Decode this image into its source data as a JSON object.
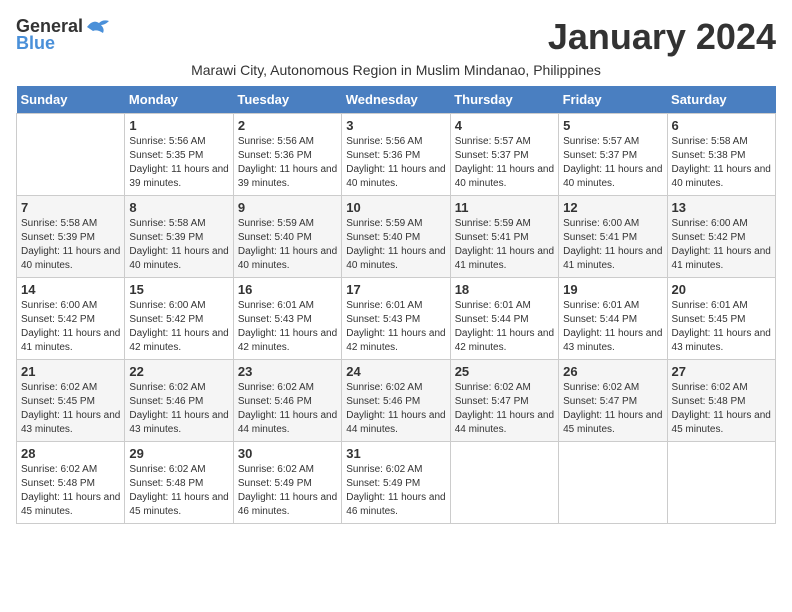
{
  "header": {
    "logo_general": "General",
    "logo_blue": "Blue",
    "month_title": "January 2024",
    "subtitle": "Marawi City, Autonomous Region in Muslim Mindanao, Philippines"
  },
  "days_of_week": [
    "Sunday",
    "Monday",
    "Tuesday",
    "Wednesday",
    "Thursday",
    "Friday",
    "Saturday"
  ],
  "weeks": [
    [
      {
        "day": "",
        "sunrise": "",
        "sunset": "",
        "daylight": ""
      },
      {
        "day": "1",
        "sunrise": "Sunrise: 5:56 AM",
        "sunset": "Sunset: 5:35 PM",
        "daylight": "Daylight: 11 hours and 39 minutes."
      },
      {
        "day": "2",
        "sunrise": "Sunrise: 5:56 AM",
        "sunset": "Sunset: 5:36 PM",
        "daylight": "Daylight: 11 hours and 39 minutes."
      },
      {
        "day": "3",
        "sunrise": "Sunrise: 5:56 AM",
        "sunset": "Sunset: 5:36 PM",
        "daylight": "Daylight: 11 hours and 40 minutes."
      },
      {
        "day": "4",
        "sunrise": "Sunrise: 5:57 AM",
        "sunset": "Sunset: 5:37 PM",
        "daylight": "Daylight: 11 hours and 40 minutes."
      },
      {
        "day": "5",
        "sunrise": "Sunrise: 5:57 AM",
        "sunset": "Sunset: 5:37 PM",
        "daylight": "Daylight: 11 hours and 40 minutes."
      },
      {
        "day": "6",
        "sunrise": "Sunrise: 5:58 AM",
        "sunset": "Sunset: 5:38 PM",
        "daylight": "Daylight: 11 hours and 40 minutes."
      }
    ],
    [
      {
        "day": "7",
        "sunrise": "Sunrise: 5:58 AM",
        "sunset": "Sunset: 5:39 PM",
        "daylight": "Daylight: 11 hours and 40 minutes."
      },
      {
        "day": "8",
        "sunrise": "Sunrise: 5:58 AM",
        "sunset": "Sunset: 5:39 PM",
        "daylight": "Daylight: 11 hours and 40 minutes."
      },
      {
        "day": "9",
        "sunrise": "Sunrise: 5:59 AM",
        "sunset": "Sunset: 5:40 PM",
        "daylight": "Daylight: 11 hours and 40 minutes."
      },
      {
        "day": "10",
        "sunrise": "Sunrise: 5:59 AM",
        "sunset": "Sunset: 5:40 PM",
        "daylight": "Daylight: 11 hours and 40 minutes."
      },
      {
        "day": "11",
        "sunrise": "Sunrise: 5:59 AM",
        "sunset": "Sunset: 5:41 PM",
        "daylight": "Daylight: 11 hours and 41 minutes."
      },
      {
        "day": "12",
        "sunrise": "Sunrise: 6:00 AM",
        "sunset": "Sunset: 5:41 PM",
        "daylight": "Daylight: 11 hours and 41 minutes."
      },
      {
        "day": "13",
        "sunrise": "Sunrise: 6:00 AM",
        "sunset": "Sunset: 5:42 PM",
        "daylight": "Daylight: 11 hours and 41 minutes."
      }
    ],
    [
      {
        "day": "14",
        "sunrise": "Sunrise: 6:00 AM",
        "sunset": "Sunset: 5:42 PM",
        "daylight": "Daylight: 11 hours and 41 minutes."
      },
      {
        "day": "15",
        "sunrise": "Sunrise: 6:00 AM",
        "sunset": "Sunset: 5:42 PM",
        "daylight": "Daylight: 11 hours and 42 minutes."
      },
      {
        "day": "16",
        "sunrise": "Sunrise: 6:01 AM",
        "sunset": "Sunset: 5:43 PM",
        "daylight": "Daylight: 11 hours and 42 minutes."
      },
      {
        "day": "17",
        "sunrise": "Sunrise: 6:01 AM",
        "sunset": "Sunset: 5:43 PM",
        "daylight": "Daylight: 11 hours and 42 minutes."
      },
      {
        "day": "18",
        "sunrise": "Sunrise: 6:01 AM",
        "sunset": "Sunset: 5:44 PM",
        "daylight": "Daylight: 11 hours and 42 minutes."
      },
      {
        "day": "19",
        "sunrise": "Sunrise: 6:01 AM",
        "sunset": "Sunset: 5:44 PM",
        "daylight": "Daylight: 11 hours and 43 minutes."
      },
      {
        "day": "20",
        "sunrise": "Sunrise: 6:01 AM",
        "sunset": "Sunset: 5:45 PM",
        "daylight": "Daylight: 11 hours and 43 minutes."
      }
    ],
    [
      {
        "day": "21",
        "sunrise": "Sunrise: 6:02 AM",
        "sunset": "Sunset: 5:45 PM",
        "daylight": "Daylight: 11 hours and 43 minutes."
      },
      {
        "day": "22",
        "sunrise": "Sunrise: 6:02 AM",
        "sunset": "Sunset: 5:46 PM",
        "daylight": "Daylight: 11 hours and 43 minutes."
      },
      {
        "day": "23",
        "sunrise": "Sunrise: 6:02 AM",
        "sunset": "Sunset: 5:46 PM",
        "daylight": "Daylight: 11 hours and 44 minutes."
      },
      {
        "day": "24",
        "sunrise": "Sunrise: 6:02 AM",
        "sunset": "Sunset: 5:46 PM",
        "daylight": "Daylight: 11 hours and 44 minutes."
      },
      {
        "day": "25",
        "sunrise": "Sunrise: 6:02 AM",
        "sunset": "Sunset: 5:47 PM",
        "daylight": "Daylight: 11 hours and 44 minutes."
      },
      {
        "day": "26",
        "sunrise": "Sunrise: 6:02 AM",
        "sunset": "Sunset: 5:47 PM",
        "daylight": "Daylight: 11 hours and 45 minutes."
      },
      {
        "day": "27",
        "sunrise": "Sunrise: 6:02 AM",
        "sunset": "Sunset: 5:48 PM",
        "daylight": "Daylight: 11 hours and 45 minutes."
      }
    ],
    [
      {
        "day": "28",
        "sunrise": "Sunrise: 6:02 AM",
        "sunset": "Sunset: 5:48 PM",
        "daylight": "Daylight: 11 hours and 45 minutes."
      },
      {
        "day": "29",
        "sunrise": "Sunrise: 6:02 AM",
        "sunset": "Sunset: 5:48 PM",
        "daylight": "Daylight: 11 hours and 45 minutes."
      },
      {
        "day": "30",
        "sunrise": "Sunrise: 6:02 AM",
        "sunset": "Sunset: 5:49 PM",
        "daylight": "Daylight: 11 hours and 46 minutes."
      },
      {
        "day": "31",
        "sunrise": "Sunrise: 6:02 AM",
        "sunset": "Sunset: 5:49 PM",
        "daylight": "Daylight: 11 hours and 46 minutes."
      },
      {
        "day": "",
        "sunrise": "",
        "sunset": "",
        "daylight": ""
      },
      {
        "day": "",
        "sunrise": "",
        "sunset": "",
        "daylight": ""
      },
      {
        "day": "",
        "sunrise": "",
        "sunset": "",
        "daylight": ""
      }
    ]
  ]
}
